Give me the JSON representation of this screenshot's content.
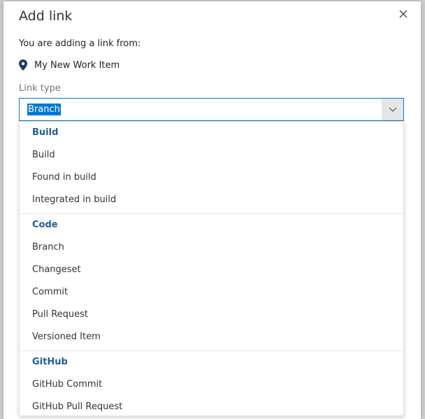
{
  "dialog": {
    "title": "Add link",
    "intro": "You are adding a link from:",
    "source_item": "My New Work Item",
    "link_type_label": "Link type",
    "link_type_value": "Branch"
  },
  "dropdown": {
    "groups": [
      {
        "header": "Build",
        "options": [
          "Build",
          "Found in build",
          "Integrated in build"
        ]
      },
      {
        "header": "Code",
        "options": [
          "Branch",
          "Changeset",
          "Commit",
          "Pull Request",
          "Versioned Item"
        ]
      },
      {
        "header": "GitHub",
        "options": [
          "GitHub Commit",
          "GitHub Pull Request"
        ]
      }
    ]
  },
  "colors": {
    "accent": "#0078d4",
    "group_header": "#1f5e9c",
    "label_gray": "#767676"
  },
  "icons": {
    "close": "close-icon",
    "location": "map-pin-icon",
    "dropdown": "chevron-down-icon"
  }
}
